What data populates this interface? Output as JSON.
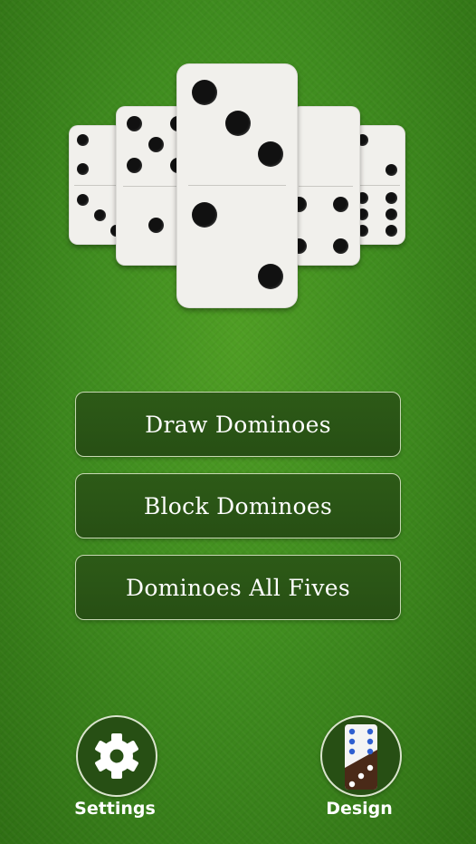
{
  "menu": {
    "draw_label": "Draw Dominoes",
    "block_label": "Block Dominoes",
    "fives_label": "Dominoes All Fives"
  },
  "bottom": {
    "settings_label": "Settings",
    "design_label": "Design",
    "settings_icon": "gear-icon",
    "design_icon": "domino-design-icon"
  },
  "colors": {
    "background": "#3f8c1f",
    "button_fill": "#274f14",
    "button_border": "#c7d8b3",
    "tile": "#f1f0ec",
    "pip": "#111111",
    "design_pip_blue": "#2f5fd0"
  }
}
